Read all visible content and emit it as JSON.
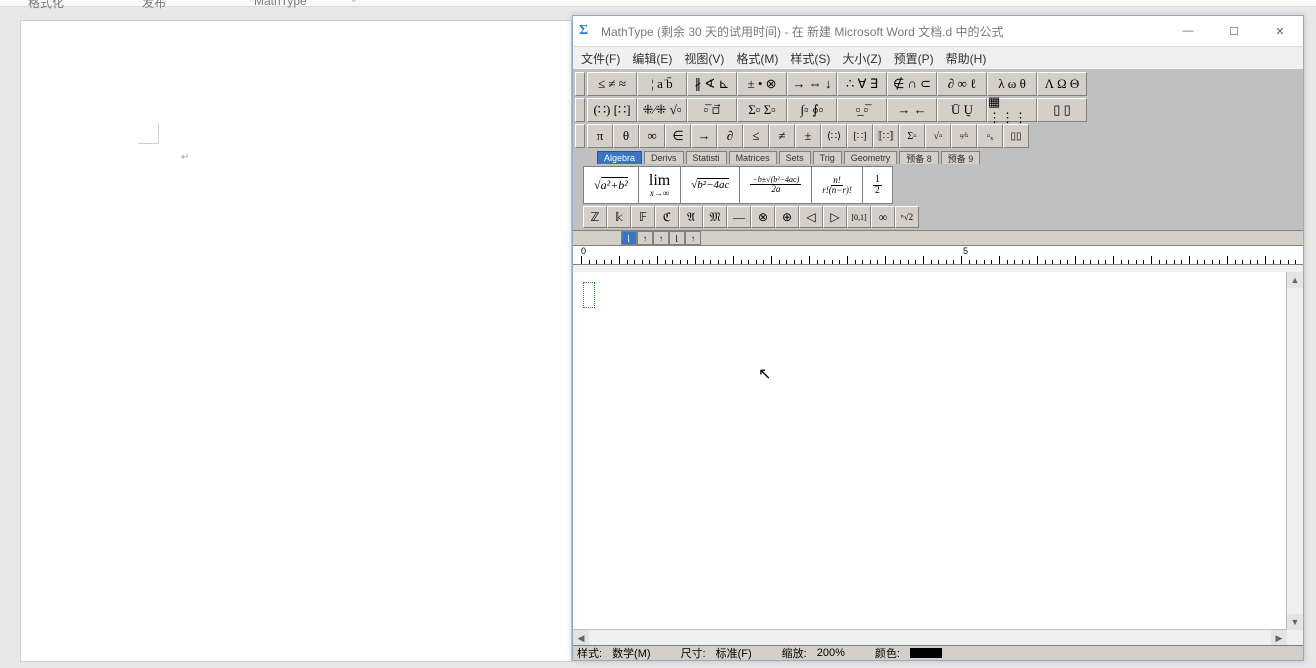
{
  "word": {
    "ribbon_labels": {
      "l1": "格式化",
      "l2": "发布",
      "l3": "MathType"
    },
    "caret": "↵"
  },
  "title": "MathType (剩余 30 天的试用时间) - 在 新建 Microsoft Word 文档.d 中的公式",
  "sigma": "Σ",
  "winbtns": {
    "min": "—",
    "max": "☐",
    "close": "✕"
  },
  "menu": [
    "文件(F)",
    "编辑(E)",
    "视图(V)",
    "格式(M)",
    "样式(S)",
    "大小(Z)",
    "预置(P)",
    "帮助(H)"
  ],
  "row1": {
    "g1": "≤ ≠ ≈",
    "g2": "¦ a͘ b̄",
    "g3": "∦ ∢ ⊾",
    "g4": "± • ⊗",
    "g5": "→ ⇔ ↓",
    "g6": "∴ ∀ ∃",
    "g7": "∉ ∩ ⊂",
    "g8": "∂ ∞ ℓ",
    "g9": "λ ω θ",
    "g10": "Λ Ω Θ"
  },
  "row2": {
    "g1": "(∷) [∷]",
    "g2": "⁜⁄⁜ √▫",
    "g3": "▫̅ ▫⃗",
    "g4": "Σ▫ Σ▫",
    "g5": "∫▫ ∮▫",
    "g6": "▫̲ ▫̅",
    "g7": "→ ←",
    "g8": "Ū Ṵ",
    "g9": "▦ ⋮⋮⋮",
    "g10": "▯ ▯"
  },
  "row3": [
    "π",
    "θ",
    "∞",
    "∈",
    "→",
    "∂",
    "≤",
    "≠",
    "±",
    "⟨∷⟩",
    "[∷]",
    "⟦∷⟧",
    "Σ▫",
    "√▫",
    "▫⁄▫",
    "▫ₓ",
    "▯▯"
  ],
  "tabs": [
    "Algebra",
    "Derivs",
    "Statisti",
    "Matrices",
    "Sets",
    "Trig",
    "Geometry",
    "预备 8",
    "预备 9"
  ],
  "bigbtns": {
    "b1": "√(a²+b²)",
    "b2_top": "lim",
    "b2_bot": "x→∞",
    "b3": "√(b²−4ac)",
    "b4_top": "−b±√(b²−4ac)",
    "b4_bot": "2a",
    "b5_top": "n!",
    "b5_bot": "r!(n−r)!",
    "b6_top": "1",
    "b6_bot": "2"
  },
  "row4": [
    "ℤ",
    "𝕜",
    "𝔽",
    "ℭ",
    "𝔄",
    "𝔐",
    "—",
    "⊗",
    "⊕",
    "◁",
    "▷",
    "[0,1]",
    "∞",
    "ⁿ√2"
  ],
  "tabstops": [
    "⌊",
    "↑",
    "↑",
    "⌊",
    "↑"
  ],
  "ruler": {
    "n0": "0",
    "n5": "5"
  },
  "status": {
    "style_lbl": "样式:",
    "style_val": "数学(M)",
    "size_lbl": "尺寸:",
    "size_val": "标准(F)",
    "zoom_lbl": "缩放:",
    "zoom_val": "200%",
    "color_lbl": "颜色:"
  }
}
